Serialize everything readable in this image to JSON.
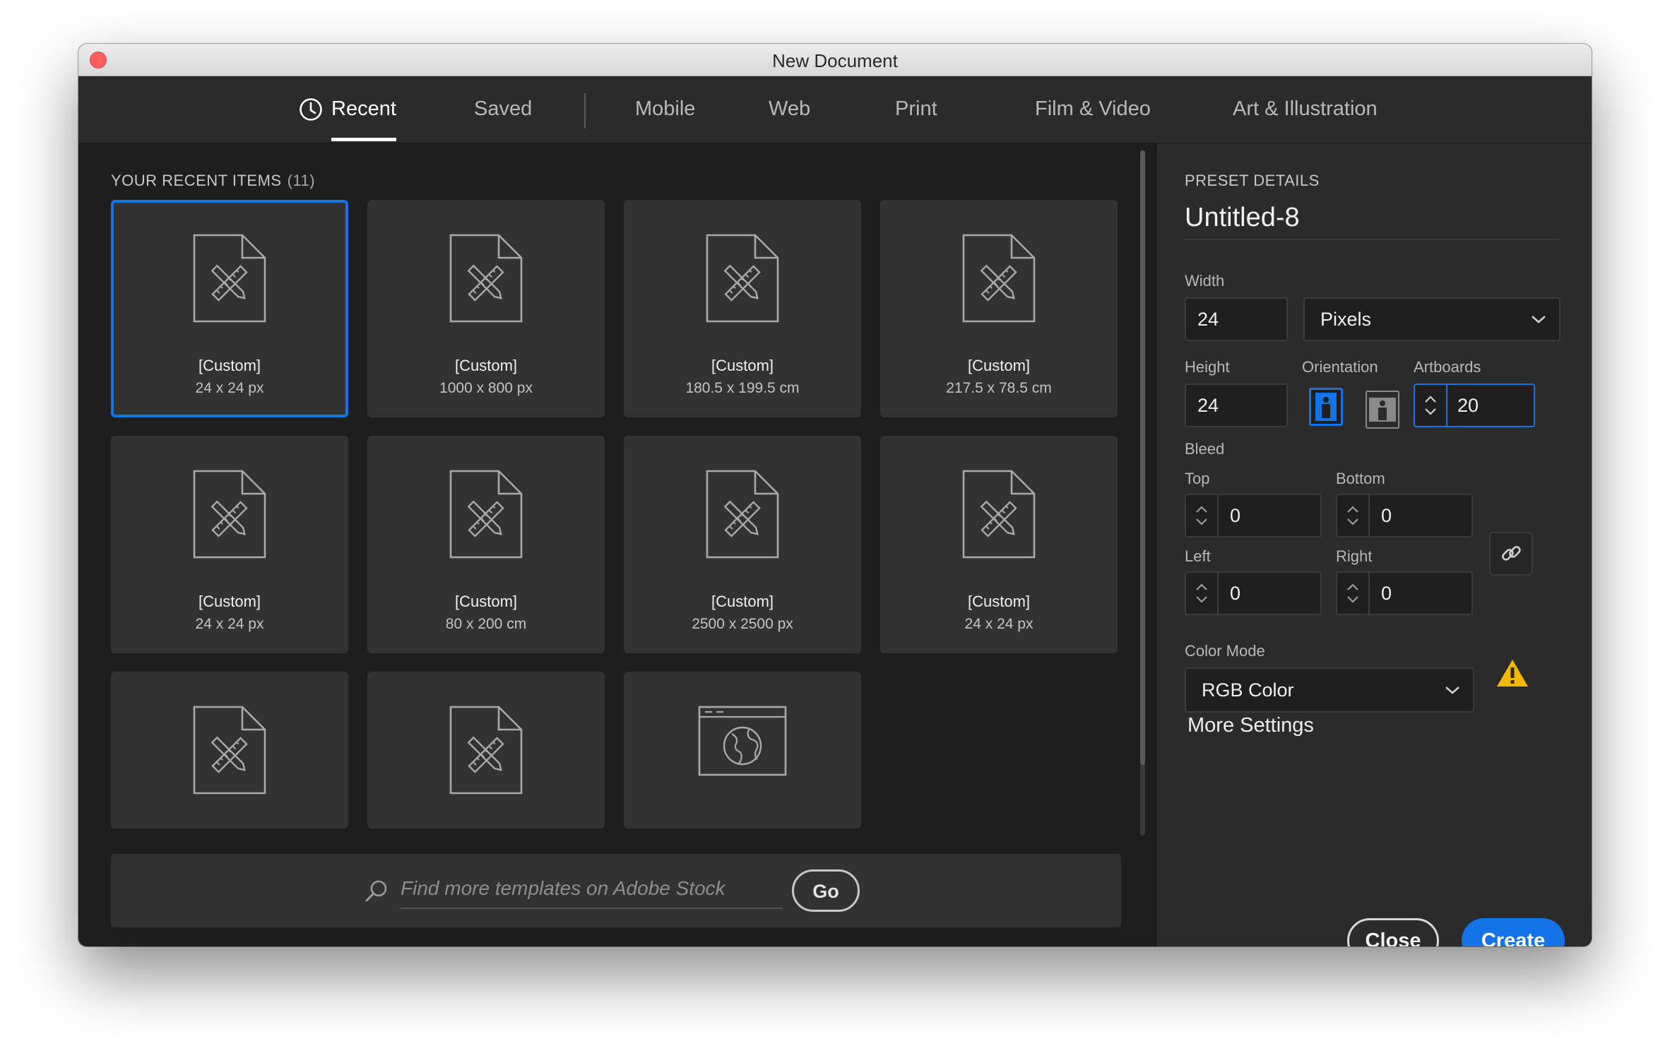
{
  "window": {
    "title": "New Document"
  },
  "tabs": [
    {
      "label": "Recent",
      "active": true,
      "icon": "clock-icon"
    },
    {
      "label": "Saved"
    },
    {
      "label": "Mobile"
    },
    {
      "label": "Web"
    },
    {
      "label": "Print"
    },
    {
      "label": "Film & Video"
    },
    {
      "label": "Art & Illustration"
    }
  ],
  "recent": {
    "heading": "YOUR RECENT ITEMS",
    "count": "(11)",
    "items": [
      {
        "name": "[Custom]",
        "size": "24 x 24 px",
        "selected": true,
        "icon": "document-ruler-pencil-icon"
      },
      {
        "name": "[Custom]",
        "size": "1000 x 800 px",
        "icon": "document-ruler-pencil-icon"
      },
      {
        "name": "[Custom]",
        "size": "180.5 x 199.5 cm",
        "icon": "document-ruler-pencil-icon"
      },
      {
        "name": "[Custom]",
        "size": "217.5 x 78.5 cm",
        "icon": "document-ruler-pencil-icon"
      },
      {
        "name": "[Custom]",
        "size": "24 x 24 px",
        "icon": "document-ruler-pencil-icon"
      },
      {
        "name": "[Custom]",
        "size": "80 x 200 cm",
        "icon": "document-ruler-pencil-icon"
      },
      {
        "name": "[Custom]",
        "size": "2500 x 2500 px",
        "icon": "document-ruler-pencil-icon"
      },
      {
        "name": "[Custom]",
        "size": "24 x 24 px",
        "icon": "document-ruler-pencil-icon"
      },
      {
        "name": "",
        "size": "",
        "icon": "document-ruler-pencil-icon"
      },
      {
        "name": "",
        "size": "",
        "icon": "document-ruler-pencil-icon"
      },
      {
        "name": "",
        "size": "",
        "icon": "web-globe-icon"
      }
    ]
  },
  "search": {
    "placeholder": "Find more templates on Adobe Stock",
    "button": "Go"
  },
  "preset": {
    "heading": "PRESET DETAILS",
    "name": "Untitled-8",
    "width_label": "Width",
    "width": "24",
    "units": "Pixels",
    "height_label": "Height",
    "height": "24",
    "orientation_label": "Orientation",
    "orientation": "portrait",
    "artboards_label": "Artboards",
    "artboards": "20",
    "bleed_label": "Bleed",
    "bleed": {
      "top_label": "Top",
      "top": "0",
      "bottom_label": "Bottom",
      "bottom": "0",
      "left_label": "Left",
      "left": "0",
      "right_label": "Right",
      "right": "0"
    },
    "color_mode_label": "Color Mode",
    "color_mode": "RGB Color",
    "more_settings": "More Settings"
  },
  "buttons": {
    "close": "Close",
    "create": "Create"
  },
  "colors": {
    "accent": "#1473e6",
    "warning": "#f5b800"
  }
}
